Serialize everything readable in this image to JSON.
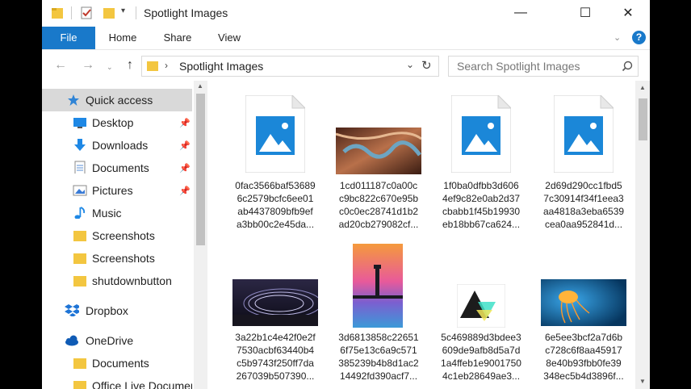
{
  "window": {
    "title": "Spotlight Images",
    "controls": {
      "minimize": "—",
      "maximize": "☐",
      "close": "✕"
    }
  },
  "ribbon": {
    "tabs": [
      {
        "label": "File"
      },
      {
        "label": "Home"
      },
      {
        "label": "Share"
      },
      {
        "label": "View"
      }
    ],
    "help": "?"
  },
  "address": {
    "path": "Spotlight Images",
    "search_placeholder": "Search Spotlight Images"
  },
  "nav": {
    "quick_access": "Quick access",
    "items": [
      {
        "label": "Desktop",
        "icon": "desktop-icon",
        "pinned": true
      },
      {
        "label": "Downloads",
        "icon": "download-icon",
        "pinned": true
      },
      {
        "label": "Documents",
        "icon": "documents-icon",
        "pinned": true
      },
      {
        "label": "Pictures",
        "icon": "pictures-icon",
        "pinned": true
      },
      {
        "label": "Music",
        "icon": "music-icon",
        "pinned": false
      },
      {
        "label": "Screenshots",
        "icon": "folder-icon",
        "pinned": false
      },
      {
        "label": "Screenshots",
        "icon": "folder-icon",
        "pinned": false
      },
      {
        "label": "shutdownbutton",
        "icon": "folder-icon",
        "pinned": false
      }
    ],
    "dropbox": "Dropbox",
    "onedrive": "OneDrive",
    "onedrive_items": [
      {
        "label": "Documents"
      },
      {
        "label": "Office Live Documen"
      }
    ]
  },
  "files": [
    {
      "line1": "0fac3566baf53689",
      "line2": "6c2579bcfc6ee01",
      "line3": "ab4437809bfb9ef",
      "line4": "a3bb00c2e45da...",
      "thumb": "generic"
    },
    {
      "line1": "1cd011187c0a00c",
      "line2": "c9bc822c670e95b",
      "line3": "c0c0ec28741d1b2",
      "line4": "ad20cb279082cf...",
      "thumb": "canyon-river"
    },
    {
      "line1": "1f0ba0dfbb3d606",
      "line2": "4ef9c82e0ab2d37",
      "line3": "cbabb1f45b19930",
      "line4": "eb18bb67ca624...",
      "thumb": "generic"
    },
    {
      "line1": "2d69d290cc1fbd5",
      "line2": "7c30914f34f1eea3",
      "line3": "aa4818a3eba6539",
      "line4": "cea0aa952841d...",
      "thumb": "generic"
    },
    {
      "line1": "3a22b1c4e42f0e2f",
      "line2": "7530acbf63440b4",
      "line3": "c5b9743f250ff7da",
      "line4": "267039b507390...",
      "thumb": "light-trails"
    },
    {
      "line1": "3d6813858c22651",
      "line2": "6f75e13c6a9c571",
      "line3": "385239b4b8d1ac2",
      "line4": "14492fd390acf7...",
      "thumb": "lighthouse"
    },
    {
      "line1": "5c469889d3bdee3",
      "line2": "609de9afb8d5a7d",
      "line3": "1a4ffeb1e9001750",
      "line4": "4c1eb28649ae3...",
      "thumb": "triangle-logo"
    },
    {
      "line1": "6e5ee3bcf2a7d6b",
      "line2": "c728c6f8aa45917",
      "line3": "8e40b93fbb0fe39",
      "line4": "348ec5b4d3896f...",
      "thumb": "jellyfish"
    }
  ],
  "colors": {
    "accent": "#1979ca",
    "folder": "#f3c640",
    "selected": "#cce8ff"
  }
}
